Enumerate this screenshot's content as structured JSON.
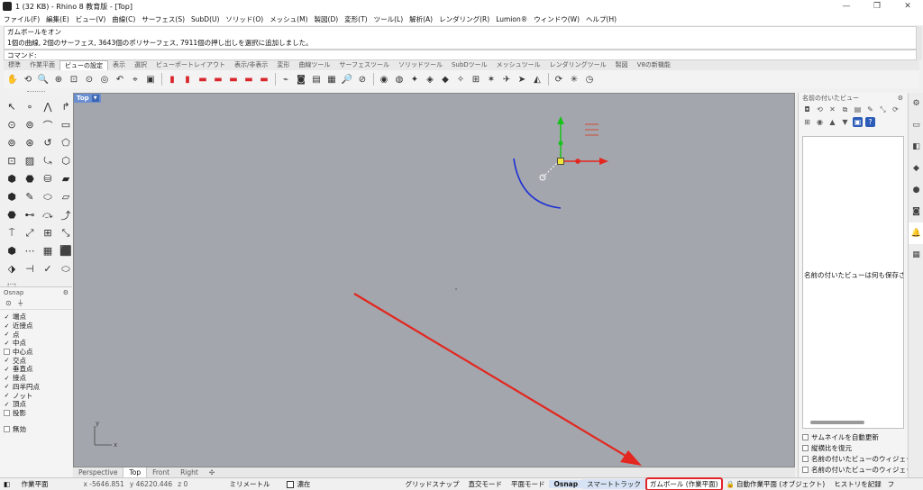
{
  "window": {
    "title": "1 (32 KB) - Rhino 8 教育版 - [Top]",
    "controls": [
      "—",
      "❐",
      "✕"
    ]
  },
  "menu": [
    "ファイル(F)",
    "編集(E)",
    "ビュー(V)",
    "曲線(C)",
    "サーフェス(S)",
    "SubD(U)",
    "ソリッド(O)",
    "メッシュ(M)",
    "製図(D)",
    "変形(T)",
    "ツール(L)",
    "解析(A)",
    "レンダリング(R)",
    "Lumion®",
    "ウィンドウ(W)",
    "ヘルプ(H)"
  ],
  "command": {
    "history": [
      "ガムボールをオン",
      "1個の曲線, 2個のサーフェス, 3643個のポリサーフェス, 7911個の押し出しを選択に追加しました。"
    ],
    "prompt": "コマンド:",
    "value": ""
  },
  "toolbar_tabs": [
    {
      "label": "標準",
      "active": false
    },
    {
      "label": "作業平面",
      "active": false
    },
    {
      "label": "ビューの設定",
      "active": true
    },
    {
      "label": "表示",
      "active": false
    },
    {
      "label": "選択",
      "active": false
    },
    {
      "label": "ビューポートレイアウト",
      "active": false
    },
    {
      "label": "表示/非表示",
      "active": false
    },
    {
      "label": "変形",
      "active": false
    },
    {
      "label": "曲線ツール",
      "active": false
    },
    {
      "label": "サーフェスツール",
      "active": false
    },
    {
      "label": "ソリッドツール",
      "active": false
    },
    {
      "label": "SubDツール",
      "active": false
    },
    {
      "label": "メッシュツール",
      "active": false
    },
    {
      "label": "レンダリングツール",
      "active": false
    },
    {
      "label": "製図",
      "active": false
    },
    {
      "label": "V8の新機能",
      "active": false
    }
  ],
  "toolbar_icons": [
    {
      "name": "pan-icon",
      "glyph": "✋"
    },
    {
      "name": "rotate-view-icon",
      "glyph": "⟲"
    },
    {
      "name": "zoom-icon",
      "glyph": "🔍"
    },
    {
      "name": "zoom-window-icon",
      "glyph": "⊕"
    },
    {
      "name": "zoom-extents-icon",
      "glyph": "⊡"
    },
    {
      "name": "zoom-selected-icon",
      "glyph": "⊙"
    },
    {
      "name": "zoom-extents-all-icon",
      "glyph": "◎"
    },
    {
      "name": "undo-view-icon",
      "glyph": "↶"
    },
    {
      "name": "zoom-target-icon",
      "glyph": "⌖"
    },
    {
      "name": "named-view-icon",
      "glyph": "▣"
    },
    {
      "name": "sep",
      "glyph": ""
    },
    {
      "name": "shaded-car-icon",
      "glyph": "▮"
    },
    {
      "name": "car-view-icon",
      "glyph": "▮"
    },
    {
      "name": "car-view-icon",
      "glyph": "▬"
    },
    {
      "name": "car-view-icon",
      "glyph": "▬"
    },
    {
      "name": "car-view-icon",
      "glyph": "▬"
    },
    {
      "name": "car-view-icon",
      "glyph": "▬"
    },
    {
      "name": "car-view-icon",
      "glyph": "▬"
    },
    {
      "name": "sep",
      "glyph": ""
    },
    {
      "name": "camera-icon",
      "glyph": "⌁"
    },
    {
      "name": "capture-icon",
      "glyph": "◙"
    },
    {
      "name": "screenshot-icon",
      "glyph": "▤"
    },
    {
      "name": "print-icon",
      "glyph": "▦"
    },
    {
      "name": "zoom-lens-icon",
      "glyph": "🔎"
    },
    {
      "name": "analyze-icon",
      "glyph": "⊘"
    },
    {
      "name": "sep",
      "glyph": ""
    },
    {
      "name": "target-icon",
      "glyph": "◉"
    },
    {
      "name": "orbit-icon",
      "glyph": "◍"
    },
    {
      "name": "walk-icon",
      "glyph": "✦"
    },
    {
      "name": "fly-icon",
      "glyph": "◈"
    },
    {
      "name": "perspective-icon",
      "glyph": "◆"
    },
    {
      "name": "two-point-icon",
      "glyph": "✧"
    },
    {
      "name": "top-icon",
      "glyph": "⊞"
    },
    {
      "name": "axon-icon",
      "glyph": "✶"
    },
    {
      "name": "plane-icon",
      "glyph": "✈"
    },
    {
      "name": "jet-icon",
      "glyph": "➤"
    },
    {
      "name": "boat-icon",
      "glyph": "◭"
    },
    {
      "name": "sep",
      "glyph": ""
    },
    {
      "name": "turntable-360-icon",
      "glyph": "⟳"
    },
    {
      "name": "sun-icon",
      "glyph": "✳"
    },
    {
      "name": "clock-icon",
      "glyph": "◷"
    }
  ],
  "left_palette": [
    "↖",
    "∘",
    "⋀",
    "↱",
    "⊙",
    "⊚",
    "⌒",
    "▭",
    "⊚",
    "⊛",
    "↺",
    "⬠",
    "⊡",
    "▨",
    "⤿",
    "⬡",
    "⬢",
    "⬣",
    "⛁",
    "▰",
    "⬢",
    "✎",
    "⬭",
    "▱",
    "⬣",
    "⊷",
    "⤼",
    "⤴",
    "⍑",
    "⤢",
    "⊞",
    "⤡",
    "⬢",
    "⋯",
    "▦",
    "⬛",
    "⬗",
    "⊣",
    "✓",
    "⬭",
    "⬚"
  ],
  "osnap": {
    "title": "Osnap",
    "items": [
      {
        "label": "端点",
        "checked": true
      },
      {
        "label": "近接点",
        "checked": true
      },
      {
        "label": "点",
        "checked": true
      },
      {
        "label": "中点",
        "checked": true
      },
      {
        "label": "中心点",
        "checked": false
      },
      {
        "label": "交点",
        "checked": true
      },
      {
        "label": "垂直点",
        "checked": true
      },
      {
        "label": "接点",
        "checked": true
      },
      {
        "label": "四半円点",
        "checked": true
      },
      {
        "label": "ノット",
        "checked": true
      },
      {
        "label": "頂点",
        "checked": true
      },
      {
        "label": "投影",
        "checked": false
      }
    ],
    "disable": "無効"
  },
  "viewport": {
    "name": "Top",
    "axis_x": "x",
    "axis_y": "y",
    "background": "#a3a6ac"
  },
  "viewport_tabs": [
    {
      "label": "Perspective",
      "active": false
    },
    {
      "label": "Top",
      "active": true
    },
    {
      "label": "Front",
      "active": false
    },
    {
      "label": "Right",
      "active": false
    },
    {
      "label": "✣",
      "active": false
    }
  ],
  "named_views_panel": {
    "title": "名前の付いたビュー",
    "empty_text": "名前の付いたビューは何も保存されていません",
    "options": [
      {
        "label": "サムネイルを自動更新",
        "checked": false
      },
      {
        "label": "縦横比を復元",
        "checked": false
      },
      {
        "label": "名前の付いたビューのウィジェット",
        "checked": false
      },
      {
        "label": "名前の付いたビューのウィジェット",
        "checked": false
      }
    ]
  },
  "status": {
    "cplane": "作業平面",
    "x": "x -5646.851",
    "y": "y 46220.446",
    "z": "z 0",
    "units": "ミリメートル",
    "layer": "濃在",
    "grid_snap": "グリッドスナップ",
    "ortho": "直交モード",
    "planar": "平面モード",
    "osnap": "Osnap",
    "smarttrack": "スマートトラック",
    "gumball": "ガムボール (作業平面)",
    "auto_cplane": "自動作業平面 (オブジェクト)",
    "history": "ヒストリを記録",
    "filter": "フ",
    "highlight_color": "#e0242a"
  }
}
